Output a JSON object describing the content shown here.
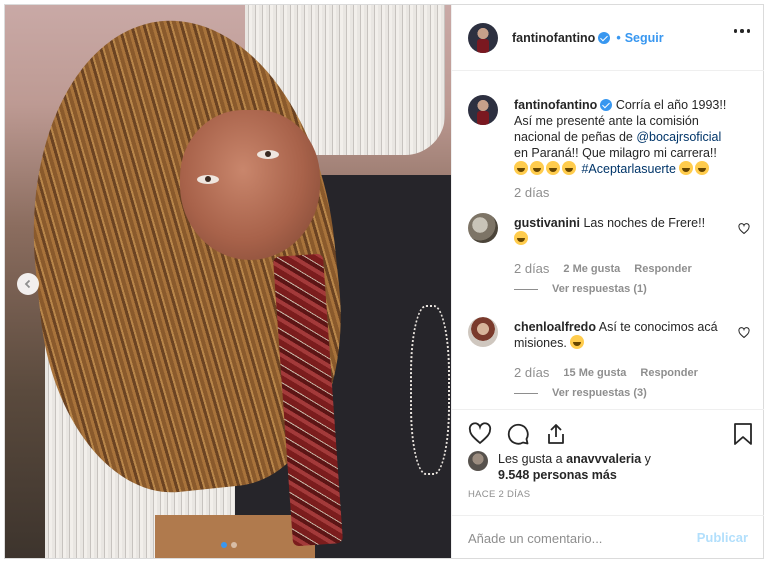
{
  "header": {
    "username": "fantinofantino",
    "separator": "•",
    "follow_label": "Seguir"
  },
  "caption": {
    "username": "fantinofantino",
    "text_1": "Corría el año 1993!! Así me presenté ante la comisión nacional de peñas de",
    "mention": "@bocajrsoficial",
    "text_2": "en Paraná!! Que milagro mi carrera!!",
    "hashtag": "#Aceptarlasuerte",
    "time": "2 días"
  },
  "comments": [
    {
      "username": "gustivanini",
      "text": "Las noches de Frere!!",
      "time": "2 días",
      "likes": "2 Me gusta",
      "reply_label": "Responder",
      "view_replies": "Ver respuestas (1)"
    },
    {
      "username": "chenloalfredo",
      "text": "Así te conocimos acá misiones.",
      "time": "2 días",
      "likes": "15 Me gusta",
      "reply_label": "Responder",
      "view_replies": "Ver respuestas (3)"
    }
  ],
  "likes": {
    "prefix": "Les gusta a",
    "user": "anavvvaleria",
    "and": "y",
    "count": "9.548 personas más"
  },
  "posted_ago": "HACE 2 DÍAS",
  "add_comment": {
    "placeholder": "Añade un comentario...",
    "publish_label": "Publicar"
  },
  "carousel": {
    "current": 1,
    "total": 2
  },
  "colors": {
    "link": "#3897f0",
    "muted": "#8e8e8e",
    "publish_disabled": "#b2dffc"
  }
}
